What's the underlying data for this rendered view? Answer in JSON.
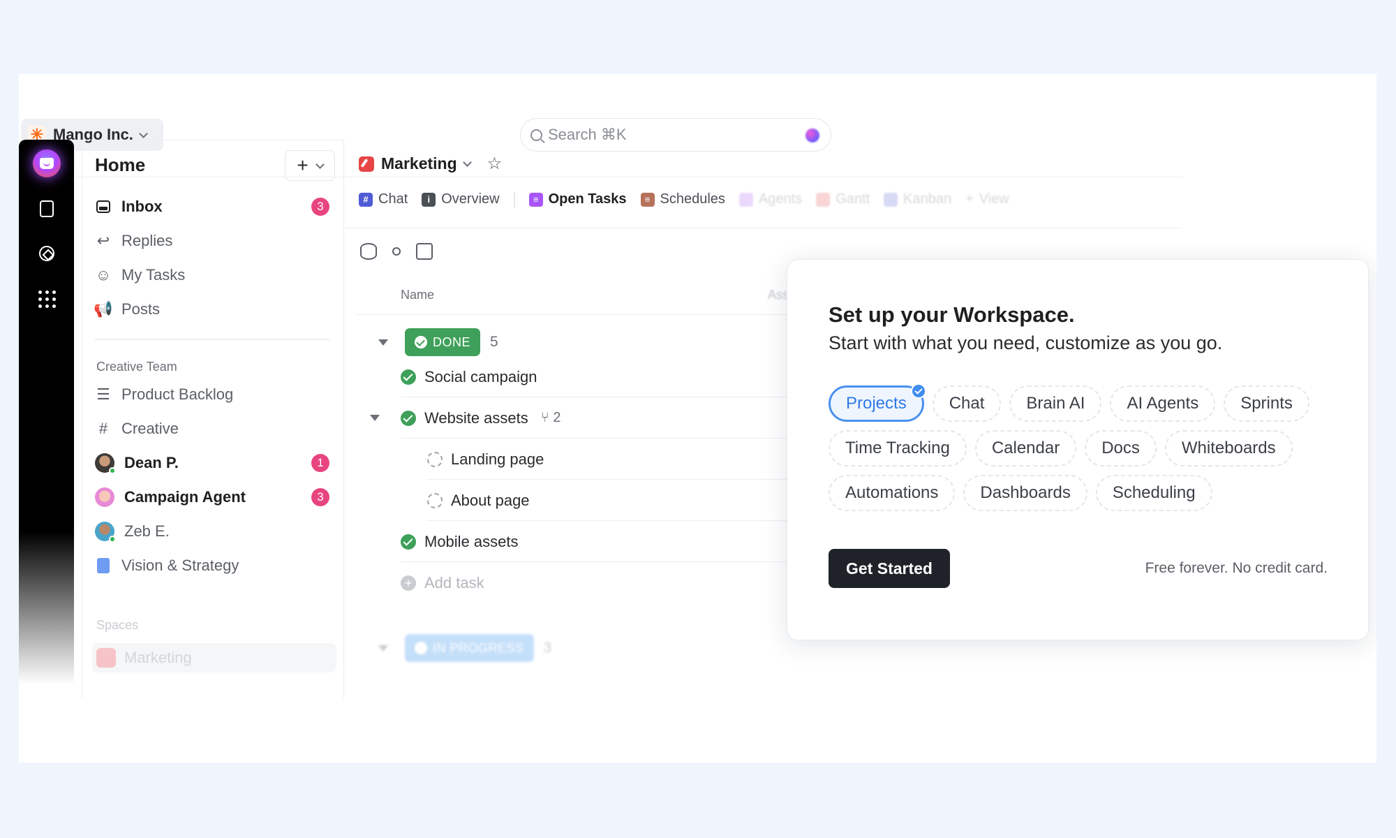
{
  "workspace": {
    "name": "Mango Inc.",
    "logo_icon": "sparkle-icon"
  },
  "search": {
    "placeholder": "Search ⌘K"
  },
  "rail": {
    "items": [
      "home-icon",
      "docs-icon",
      "ai-icon",
      "apps-icon"
    ]
  },
  "sidebar": {
    "title": "Home",
    "add_symbol": "+",
    "items": [
      {
        "label": "Inbox",
        "badge": "3"
      },
      {
        "label": "Replies"
      },
      {
        "label": "My Tasks"
      },
      {
        "label": "Posts"
      }
    ],
    "team_section": "Creative Team",
    "team_items": [
      {
        "label": "Product Backlog"
      },
      {
        "label": "Creative"
      },
      {
        "label": "Dean P.",
        "badge": "1"
      },
      {
        "label": "Campaign Agent",
        "badge": "3"
      },
      {
        "label": "Zeb E."
      },
      {
        "label": "Vision & Strategy"
      }
    ],
    "spaces_section": "Spaces",
    "spaces_items": [
      {
        "label": "Marketing"
      }
    ]
  },
  "main": {
    "title": "Marketing",
    "tabs": [
      {
        "label": "Chat",
        "color": "#4f5bd5",
        "glyph": "#"
      },
      {
        "label": "Overview",
        "color": "#4b4f56",
        "glyph": "i"
      },
      {
        "label": "Open Tasks",
        "color": "#a855f7",
        "glyph": "≡"
      },
      {
        "label": "Schedules",
        "color": "#b7715a",
        "glyph": "≡"
      },
      {
        "label": "Agents",
        "color": "#a855f7",
        "glyph": ""
      },
      {
        "label": "Gantt",
        "color": "#e64646",
        "glyph": ""
      },
      {
        "label": "Kanban",
        "color": "#4f5bd5",
        "glyph": ""
      },
      {
        "label": "View",
        "glyph": "+"
      }
    ],
    "columns": {
      "name": "Name",
      "assignee": "Assi"
    },
    "groups": {
      "done": {
        "label": "DONE",
        "count": "5"
      },
      "in_progress": {
        "label": "IN PROGRESS",
        "count": "3"
      }
    },
    "tasks": [
      {
        "name": "Social campaign",
        "status": "done"
      },
      {
        "name": "Website assets",
        "status": "done",
        "subtasks": "2"
      },
      {
        "name": "Landing page",
        "status": "todo"
      },
      {
        "name": "About page",
        "status": "todo"
      },
      {
        "name": "Mobile assets",
        "status": "done"
      }
    ],
    "add_task": "Add task"
  },
  "popup": {
    "title": "Set up your Workspace.",
    "subtitle": "Start with what you need, customize as you go.",
    "chips": [
      {
        "label": "Projects",
        "selected": true
      },
      {
        "label": "Chat"
      },
      {
        "label": "Brain AI"
      },
      {
        "label": "AI Agents"
      },
      {
        "label": "Sprints"
      },
      {
        "label": "Time Tracking"
      },
      {
        "label": "Calendar"
      },
      {
        "label": "Docs"
      },
      {
        "label": "Whiteboards"
      },
      {
        "label": "Automations"
      },
      {
        "label": "Dashboards"
      },
      {
        "label": "Scheduling"
      }
    ],
    "cta": "Get Started",
    "note": "Free forever. No credit card."
  },
  "colors": {
    "accent": "#4a90f0",
    "done": "#3ea05a",
    "badge": "#e8457e",
    "in_progress": "#5aa6f0"
  }
}
